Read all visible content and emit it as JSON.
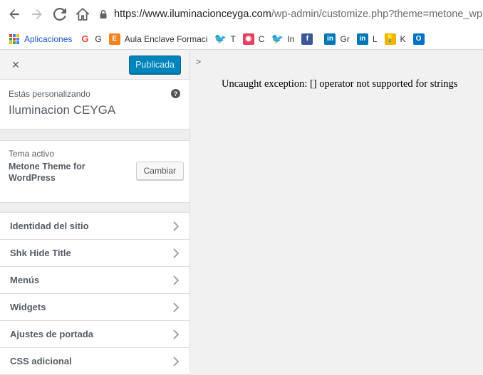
{
  "browser": {
    "url_host": "https://www.iluminacionceyga.com",
    "url_path": "/wp-admin/customize.php?theme=metone_wp"
  },
  "bookmarks": [
    {
      "icon": "apps-icon",
      "label": "Aplicaciones",
      "color": "#4285f4"
    },
    {
      "icon": "google-icon",
      "label": "G",
      "color": "#ea4335"
    },
    {
      "icon": "enclave-icon",
      "label": "Aula Enclave Formaci",
      "color": "#f4821f"
    },
    {
      "icon": "twitter-icon",
      "label": "T",
      "color": "#1da1f2"
    },
    {
      "icon": "c-icon",
      "label": "C",
      "color": "#e4405f"
    },
    {
      "icon": "twitter-icon",
      "label": "In",
      "color": "#1da1f2"
    },
    {
      "icon": "facebook-icon",
      "label": "",
      "color": "#3b5998"
    },
    {
      "icon": "linkedin-icon",
      "label": "Gr",
      "color": "#0077b5"
    },
    {
      "icon": "linkedin-icon",
      "label": "L",
      "color": "#0077b5"
    },
    {
      "icon": "bulb-icon",
      "label": "K",
      "color": "#f4b400"
    },
    {
      "icon": "outlook-icon",
      "label": "",
      "color": "#0072c6"
    }
  ],
  "customizer": {
    "close_label": "×",
    "publish_label": "Publicada",
    "customizing_label": "Estás personalizando",
    "site_title": "Iluminacion CEYGA",
    "help_label": "?",
    "active_theme_label": "Tema activo",
    "theme_name": "Metone Theme for WordPress",
    "change_label": "Cambiar",
    "sections": [
      {
        "label": "Identidad del sitio"
      },
      {
        "label": "Shk Hide Title"
      },
      {
        "label": "Menús"
      },
      {
        "label": "Widgets"
      },
      {
        "label": "Ajustes de portada"
      },
      {
        "label": "CSS adicional"
      }
    ]
  },
  "preview": {
    "gt": ">",
    "error": "Uncaught exception: [] operator not supported for strings"
  }
}
